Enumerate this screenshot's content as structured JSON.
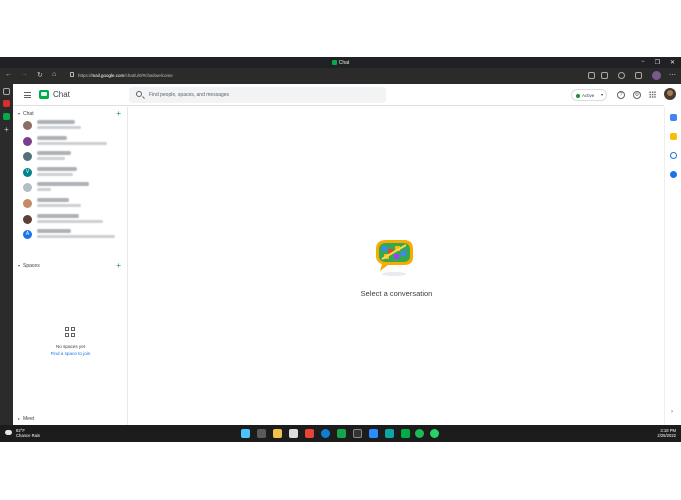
{
  "window": {
    "title": "Chat",
    "controls": [
      "−",
      "❐",
      "✕"
    ]
  },
  "browser": {
    "url_prefix": "https://",
    "url_domain": "mail.google.com",
    "url_path": "/chat/u/0/#chat/welcome"
  },
  "header": {
    "app_title": "Chat",
    "search_placeholder": "Find people, spaces, and messages",
    "status_label": "Active",
    "status_color": "#1e8e3e",
    "icons": [
      "menu-icon",
      "help-icon",
      "settings-icon",
      "apps-grid-icon"
    ]
  },
  "sidebar": {
    "chat_section_label": "Chat",
    "spaces_section_label": "Spaces",
    "meet_section_label": "Meet",
    "conversations": [
      {
        "avatar_color": "#8d6e63"
      },
      {
        "avatar_color": "#7b3f8c"
      },
      {
        "avatar_color": "#546e7a"
      },
      {
        "avatar_color": "#00838f",
        "avatar_letter": "V"
      },
      {
        "avatar_color": "#b0bec5"
      },
      {
        "avatar_color": "#c48b6a"
      },
      {
        "avatar_color": "#5d4037"
      },
      {
        "avatar_color": "#1a73e8",
        "avatar_letter": "A"
      }
    ],
    "no_spaces_text": "No spaces yet",
    "find_space_link": "Find a space to join"
  },
  "main": {
    "empty_state_text": "Select a conversation"
  },
  "taskbar": {
    "weather_temp": "82°F",
    "weather_desc": "Chance Rain",
    "time": "3:18 PM",
    "date": "2/25/2022"
  },
  "colors": {
    "accent_green": "#1e8e3e",
    "link_blue": "#1a73e8",
    "chrome_dark": "#202124"
  }
}
